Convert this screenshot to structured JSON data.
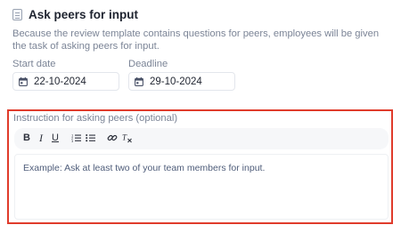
{
  "section": {
    "title": "Ask peers for input",
    "icon": "document-icon",
    "description": "Because the review template contains questions for peers, employees will be given the task of asking peers for input."
  },
  "start_date": {
    "label": "Start date",
    "value": "22-10-2024",
    "icon": "calendar-icon"
  },
  "deadline": {
    "label": "Deadline",
    "value": "29-10-2024",
    "icon": "calendar-icon"
  },
  "instruction": {
    "label": "Instruction for asking peers (optional)",
    "placeholder": "Example: Ask at least two of your team members for input.",
    "toolbar": {
      "bold": "B",
      "italic": "I",
      "underline": "U",
      "ordered_list": "ordered-list-icon",
      "bullet_list": "bullet-list-icon",
      "link": "link-icon",
      "clear_format": "clear-format-icon"
    },
    "highlight_color": "#e03b2b"
  }
}
